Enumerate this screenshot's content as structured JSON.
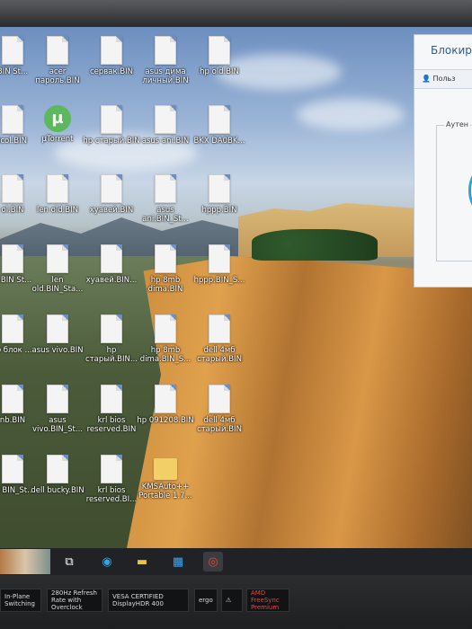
{
  "desktop_icons": [
    {
      "label": "BIN St...",
      "type": "file"
    },
    {
      "label": "acer пароль.BIN",
      "type": "file"
    },
    {
      "label": "сервак.BIN",
      "type": "file"
    },
    {
      "label": "asus дима личный.BIN",
      "type": "file"
    },
    {
      "label": "hp old.BIN",
      "type": "file"
    },
    {
      "label": "icol.BIN",
      "type": "file"
    },
    {
      "label": "µTorrent",
      "type": "app"
    },
    {
      "label": "hp старый.BIN",
      "type": "file"
    },
    {
      "label": "asus ani.BIN",
      "type": "file"
    },
    {
      "label": "BKX DA0BK...",
      "type": "file"
    },
    {
      "label": "ol.BIN",
      "type": "file"
    },
    {
      "label": "len old.BIN",
      "type": "file"
    },
    {
      "label": "хуавей.BIN",
      "type": "file"
    },
    {
      "label": "asus ani.BIN_St...",
      "type": "file"
    },
    {
      "label": "hppp.BIN",
      "type": "file"
    },
    {
      "label": "d.BIN St...",
      "type": "file"
    },
    {
      "label": "len old.BIN_Sta...",
      "type": "file"
    },
    {
      "label": "хуавей.BIN...",
      "type": "file"
    },
    {
      "label": "hp 8mb dima.BIN",
      "type": "file"
    },
    {
      "label": "hppp.BIN_S...",
      "type": "file"
    },
    {
      "label": "tp блок ...",
      "type": "file"
    },
    {
      "label": "asus vivo.BIN",
      "type": "file"
    },
    {
      "label": "hp старый.BIN...",
      "type": "file"
    },
    {
      "label": "hp 8mb dima.BIN_S...",
      "type": "file"
    },
    {
      "label": "dell 4мб старый.BIN",
      "type": "file"
    },
    {
      "label": "nb.BIN",
      "type": "file"
    },
    {
      "label": "asus vivo.BIN_St...",
      "type": "file"
    },
    {
      "label": "krl bios reserved.BIN",
      "type": "file"
    },
    {
      "label": "hp 091208.BIN",
      "type": "file"
    },
    {
      "label": "dell 4мб старый.BIN",
      "type": "file"
    },
    {
      "label": "ell BIN_St...",
      "type": "file"
    },
    {
      "label": "dell bucky.BIN",
      "type": "file"
    },
    {
      "label": "krl bios reserved.BI...",
      "type": "file"
    },
    {
      "label": "KMSAuto++ Portable 1.7...",
      "type": "folder"
    }
  ],
  "dialog": {
    "title": "Блокиро",
    "user_label": "Польз",
    "group_label": "Аутен"
  },
  "taskbar": {
    "items": [
      {
        "icon": "task-view-icon",
        "glyph": "⧉"
      },
      {
        "icon": "edge-icon",
        "glyph": "◉"
      },
      {
        "icon": "file-explorer-icon",
        "glyph": "▬"
      },
      {
        "icon": "store-icon",
        "glyph": "▦"
      },
      {
        "icon": "chrome-icon",
        "glyph": "◎"
      }
    ]
  },
  "stickers": [
    {
      "text": "In-Plane Switching"
    },
    {
      "text": "280Hz Refresh Rate with Overclock"
    },
    {
      "text": "VESA CERTIFIED DisplayHDR 400"
    },
    {
      "text": "ergo"
    },
    {
      "text": ""
    },
    {
      "text": "AMD FreeSync Premium"
    }
  ],
  "colors": {
    "accent": "#2a5e9a",
    "taskbar": "#202225"
  }
}
